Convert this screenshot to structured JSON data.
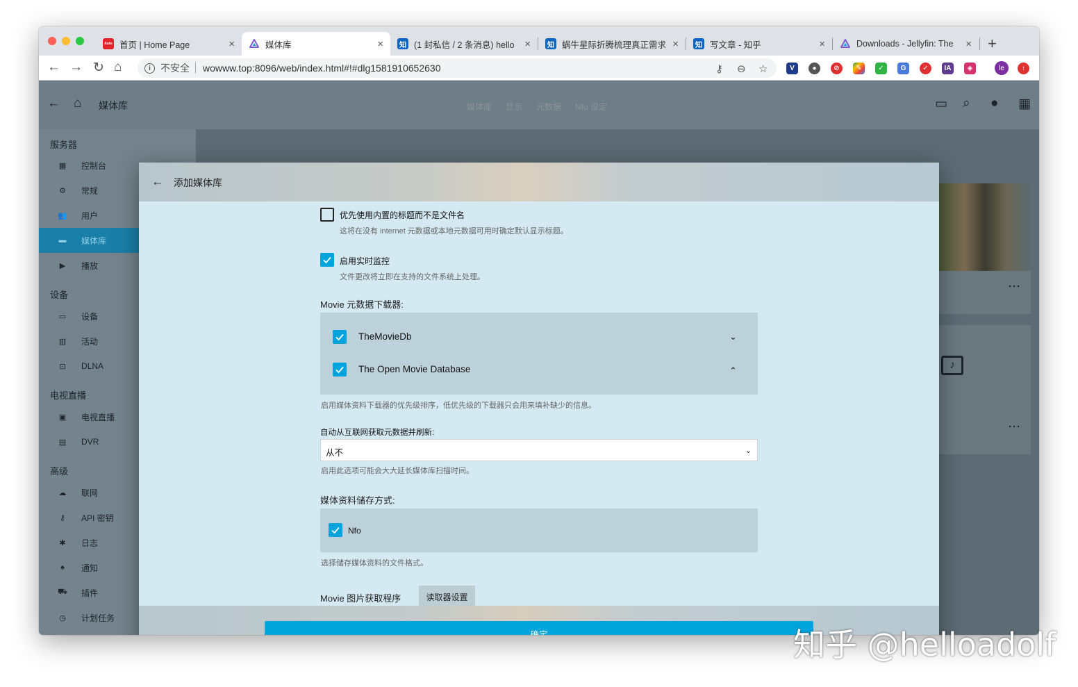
{
  "browser": {
    "tabs": [
      {
        "title": "首页 | Home Page",
        "favicon": "autohome-favicon",
        "color": "#e5222b",
        "glyph": "Auto"
      },
      {
        "title": "媒体库",
        "favicon": "jellyfin-favicon",
        "color": "#7b5bd0",
        "glyph": ""
      },
      {
        "title": "(1 封私信 / 2 条消息) hello",
        "favicon": "zhihu-favicon",
        "color": "#0a66c2",
        "glyph": "知"
      },
      {
        "title": "蜗牛星际折腾梳理真正需求",
        "favicon": "zhihu-favicon",
        "color": "#0a66c2",
        "glyph": "知"
      },
      {
        "title": "写文章 - 知乎",
        "favicon": "zhihu-favicon",
        "color": "#0a66c2",
        "glyph": "知"
      },
      {
        "title": "Downloads - Jellyfin: The",
        "favicon": "jellyfin-favicon",
        "color": "#7b5bd0",
        "glyph": ""
      }
    ],
    "close_glyph": "×",
    "new_tab_glyph": "+",
    "security_label": "不安全",
    "url": "wowww.top:8096/web/index.html#!#dlg1581910652630",
    "profile_initials": "le",
    "extension_ia": "IA"
  },
  "app": {
    "header_title": "媒体库",
    "header_tabs": [
      "媒体库",
      "显示",
      "元数据",
      "Nfo 设定"
    ]
  },
  "sidebar": {
    "sections": [
      {
        "title": "服务器",
        "items": [
          {
            "label": "控制台",
            "icon": "dashboard-icon"
          },
          {
            "label": "常规",
            "icon": "gear-icon"
          },
          {
            "label": "用户",
            "icon": "people-icon"
          },
          {
            "label": "媒体库",
            "icon": "folder-icon",
            "active": true
          },
          {
            "label": "播放",
            "icon": "play-icon"
          }
        ]
      },
      {
        "title": "设备",
        "items": [
          {
            "label": "设备",
            "icon": "devices-icon"
          },
          {
            "label": "活动",
            "icon": "activity-icon"
          },
          {
            "label": "DLNA",
            "icon": "dlna-icon"
          }
        ]
      },
      {
        "title": "电视直播",
        "items": [
          {
            "label": "电视直播",
            "icon": "live-tv-icon"
          },
          {
            "label": "DVR",
            "icon": "dvr-icon"
          }
        ]
      },
      {
        "title": "高级",
        "items": [
          {
            "label": "联网",
            "icon": "cloud-icon"
          },
          {
            "label": "API 密钥",
            "icon": "key-icon"
          },
          {
            "label": "日志",
            "icon": "bug-icon"
          },
          {
            "label": "通知",
            "icon": "bell-icon"
          },
          {
            "label": "插件",
            "icon": "cart-icon"
          },
          {
            "label": "计划任务",
            "icon": "clock-icon"
          }
        ]
      }
    ]
  },
  "dialog": {
    "title": "添加媒体库",
    "prefer_embedded_title": {
      "label": "优先使用内置的标题而不是文件名",
      "description": "这将在没有 internet 元数据或本地元数据可用时确定默认显示标题。",
      "checked": false
    },
    "realtime_monitor": {
      "label": "启用实时监控",
      "description": "文件更改将立即在支持的文件系统上处理。",
      "checked": true
    },
    "metadata_downloaders": {
      "title": "Movie 元数据下载器:",
      "items": [
        {
          "label": "TheMovieDb",
          "checked": true,
          "chevron": "chevron-down-icon"
        },
        {
          "label": "The Open Movie Database",
          "checked": true,
          "chevron": "chevron-up-icon"
        }
      ],
      "description": "启用媒体资料下载器的优先级排序，低优先级的下载器只会用来填补缺少的信息。"
    },
    "auto_refresh": {
      "label": "自动从互联网获取元数据并刷新:",
      "value": "从不",
      "description": "启用此选项可能会大大延长媒体库扫描时间。"
    },
    "metadata_savers": {
      "title": "媒体资料储存方式:",
      "items": [
        {
          "label": "Nfo",
          "checked": true
        }
      ],
      "description": "选择储存媒体资料的文件格式。"
    },
    "image_fetchers": {
      "title": "Movie 图片获取程序",
      "settings_button": "读取器设置"
    },
    "ok_button": "确定"
  },
  "watermark": "知乎 @helloadolf",
  "colors": {
    "accent": "#00a4dc",
    "dialog_bg": "#d4e9f2"
  }
}
